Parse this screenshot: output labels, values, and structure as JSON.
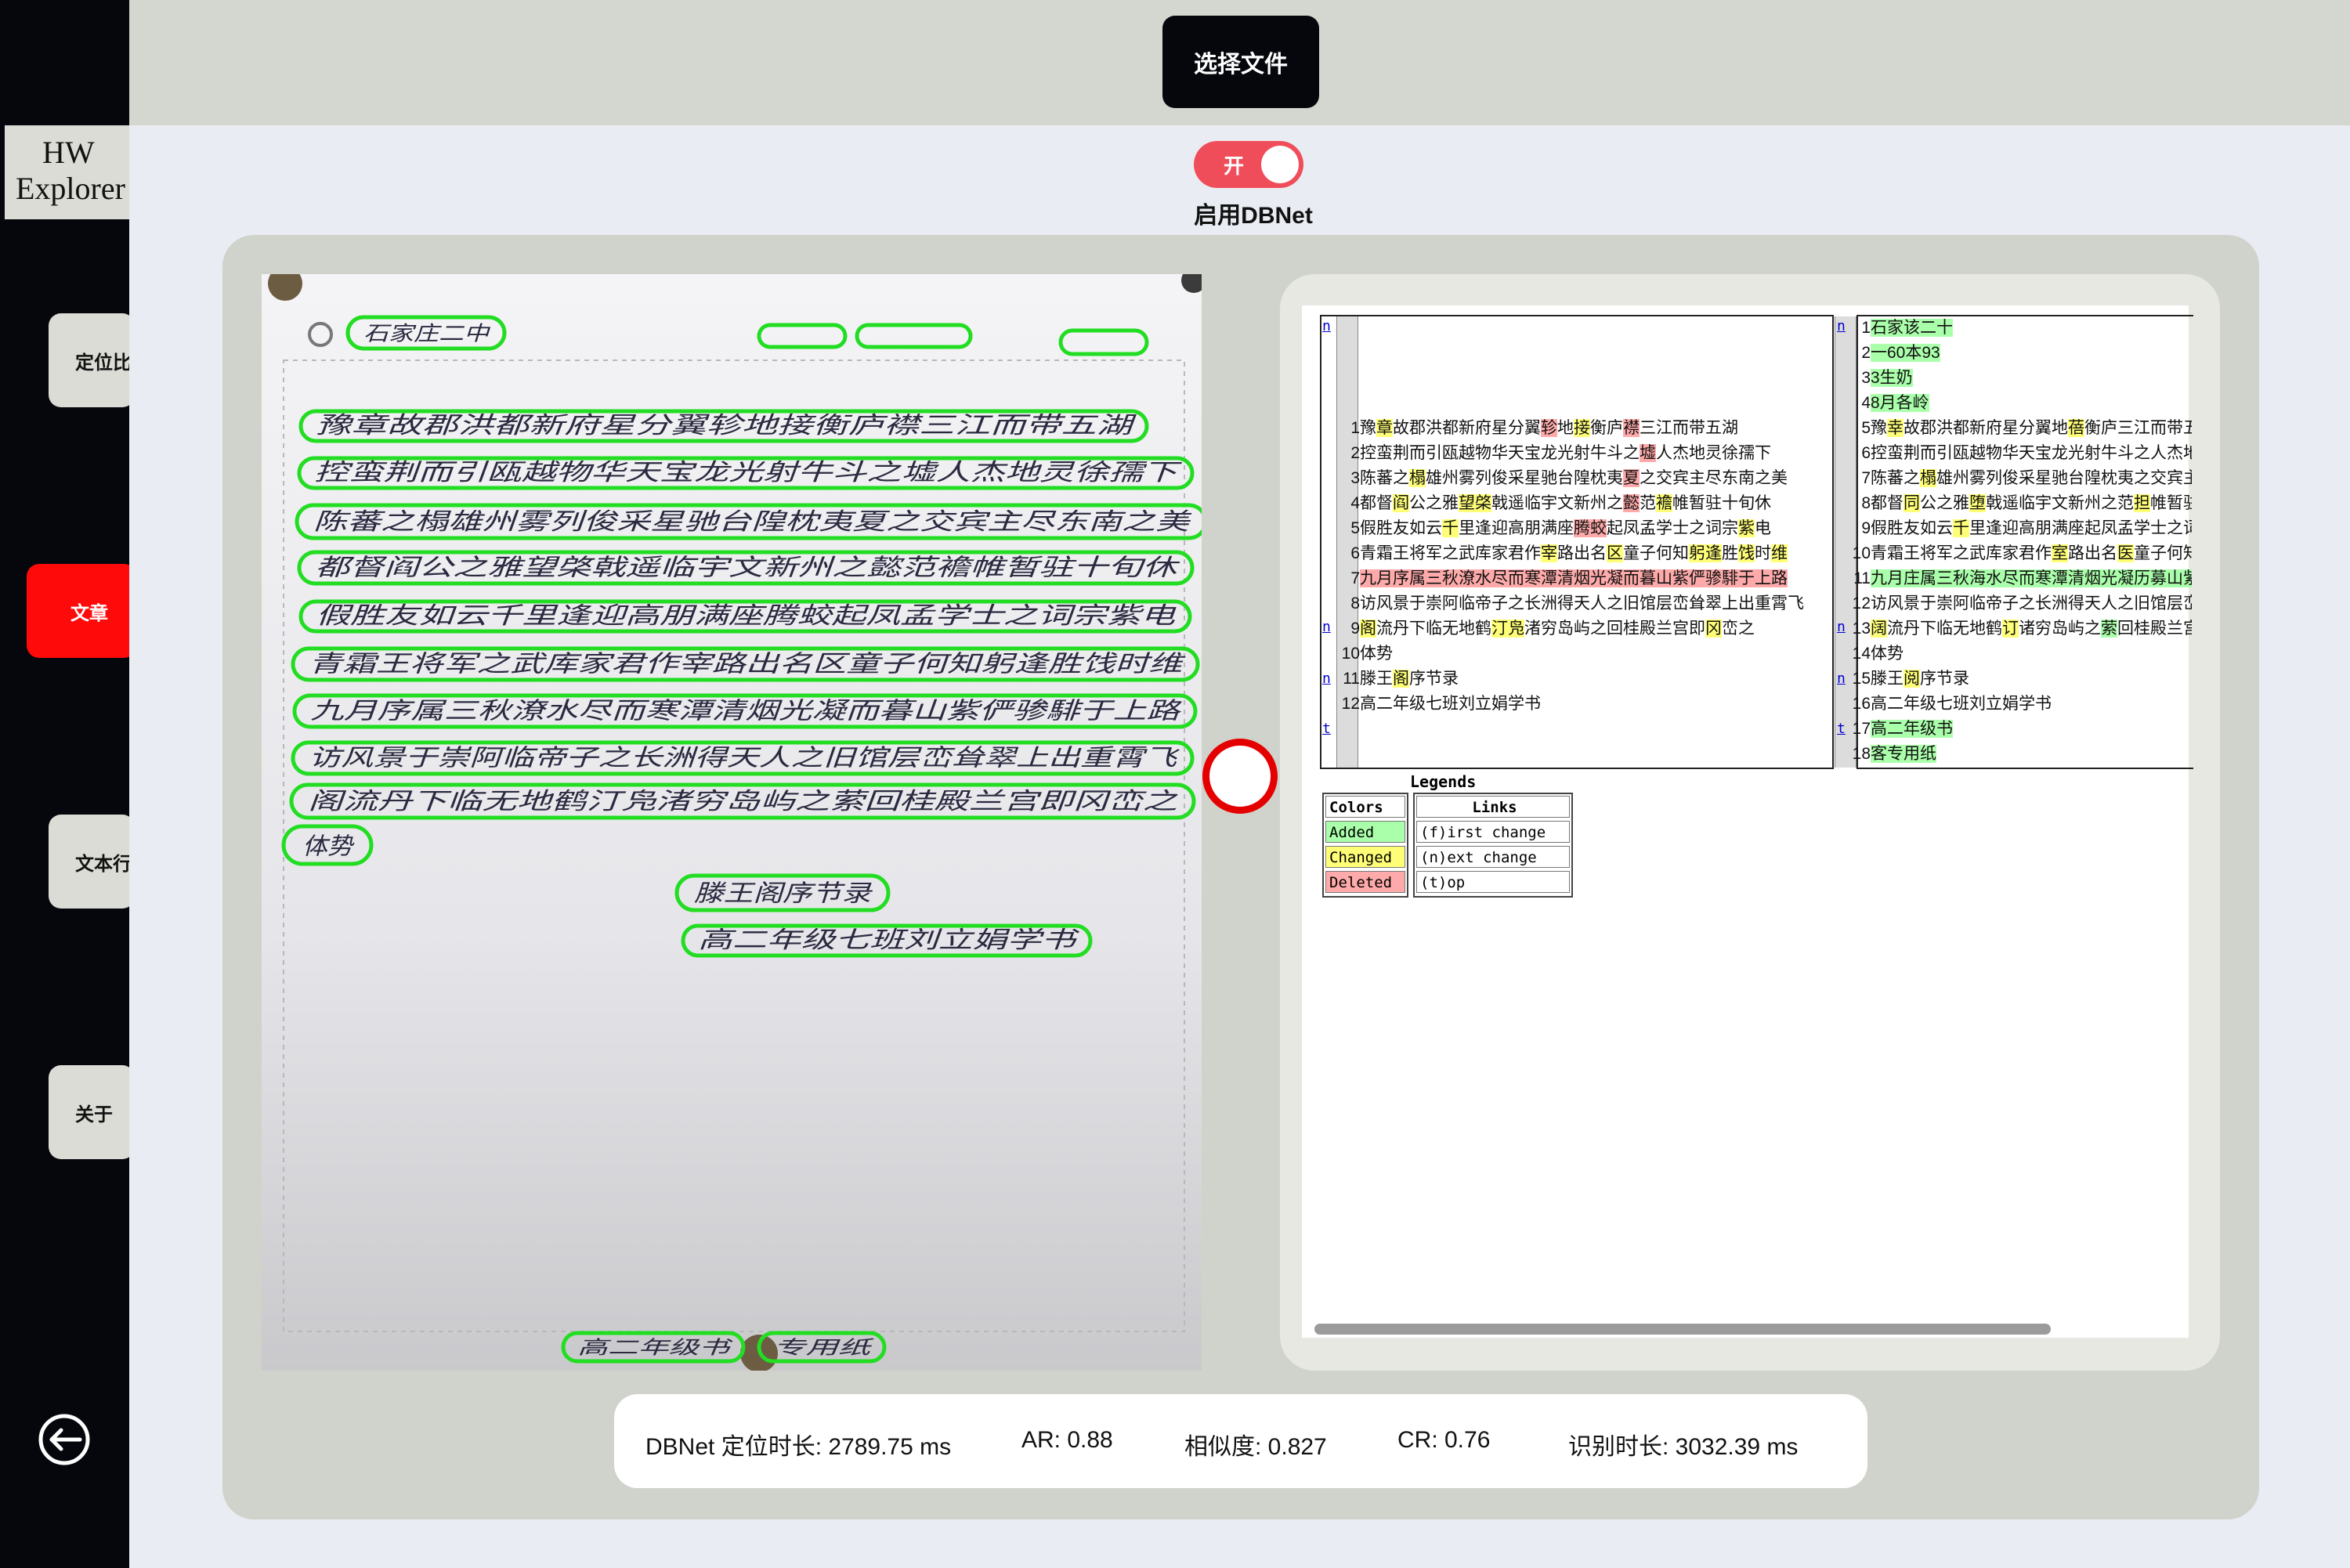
{
  "sidebar": {
    "brand_line1": "HW",
    "brand_line2": "Explorer",
    "items": [
      {
        "label": "定位比"
      },
      {
        "label": "文章"
      },
      {
        "label": "文本行"
      },
      {
        "label": "关于"
      }
    ]
  },
  "topbar": {
    "choose_file_label": "选择文件"
  },
  "toggle": {
    "state_text": "开",
    "label": "启用DBNet",
    "color": "#f04d5a"
  },
  "photo": {
    "header_texts": [
      "石家庄二中"
    ],
    "lines": [
      "豫章故郡洪都新府星分翼轸地接衡庐襟三江而带五湖",
      "控蛮荆而引瓯越物华天宝龙光射牛斗之墟人杰地灵徐孺下",
      "陈蕃之榻雄州雾列俊采星驰台隍枕夷夏之交宾主尽东南之美",
      "都督阎公之雅望棨戟遥临宇文新州之懿范襜帷暂驻十旬休",
      "假胜友如云千里逢迎高朋满座腾蛟起凤孟学士之词宗紫电",
      "青霜王将军之武库家君作宰路出名区童子何知躬逢胜饯时维",
      "九月序属三秋潦水尽而寒潭清烟光凝而暮山紫俨骖騑于上路",
      "访风景于崇阿临帝子之长洲得天人之旧馆层峦耸翠上出重霄飞",
      "阁流丹下临无地鹤汀凫渚穷岛屿之萦回桂殿兰宫即冈峦之",
      "体势",
      "滕王阁序节录",
      "高二年级七班刘立娟学书"
    ],
    "footer_texts": [
      "高二年级书",
      "专用纸"
    ]
  },
  "diff": {
    "left_links": [
      "n",
      "n",
      "n",
      "t"
    ],
    "right_links": [
      "n",
      "n",
      "n",
      "t"
    ],
    "left_rows": [
      {
        "n": "1",
        "segs": [
          {
            "t": "",
            "c": ""
          }
        ]
      },
      {
        "n": "2",
        "segs": [
          {
            "t": "",
            "c": ""
          }
        ]
      },
      {
        "n": "3",
        "segs": [
          {
            "t": "",
            "c": ""
          }
        ]
      },
      {
        "n": "4",
        "segs": [
          {
            "t": "",
            "c": ""
          }
        ]
      },
      {
        "n": "1",
        "segs": [
          {
            "t": "豫",
            "c": ""
          },
          {
            "t": "章",
            "c": "chg"
          },
          {
            "t": "故郡洪都新府星分翼",
            "c": ""
          },
          {
            "t": "轸",
            "c": "del"
          },
          {
            "t": "地",
            "c": ""
          },
          {
            "t": "接",
            "c": "chg"
          },
          {
            "t": "衡庐",
            "c": ""
          },
          {
            "t": "襟",
            "c": "del"
          },
          {
            "t": "三江而带五湖",
            "c": ""
          }
        ]
      },
      {
        "n": "2",
        "segs": [
          {
            "t": "控蛮荆而引瓯越物华天宝龙光射牛斗之",
            "c": ""
          },
          {
            "t": "墟",
            "c": "del"
          },
          {
            "t": "人杰地灵徐孺下",
            "c": ""
          }
        ]
      },
      {
        "n": "3",
        "segs": [
          {
            "t": "陈蕃之",
            "c": ""
          },
          {
            "t": "榻",
            "c": "chg"
          },
          {
            "t": "雄州雾列俊采星驰台隍枕夷",
            "c": ""
          },
          {
            "t": "夏",
            "c": "del"
          },
          {
            "t": "之交宾主尽东南之美",
            "c": ""
          }
        ]
      },
      {
        "n": "4",
        "segs": [
          {
            "t": "都督",
            "c": ""
          },
          {
            "t": "阎",
            "c": "chg"
          },
          {
            "t": "公之雅",
            "c": ""
          },
          {
            "t": "望棨",
            "c": "chg"
          },
          {
            "t": "戟遥临宇文新州之",
            "c": ""
          },
          {
            "t": "懿",
            "c": "del"
          },
          {
            "t": "范",
            "c": ""
          },
          {
            "t": "襜",
            "c": "chg"
          },
          {
            "t": "帷暂驻十旬休",
            "c": ""
          }
        ]
      },
      {
        "n": "5",
        "segs": [
          {
            "t": "假胜友如云",
            "c": ""
          },
          {
            "t": "千",
            "c": "chg"
          },
          {
            "t": "里逢迎高朋满座",
            "c": ""
          },
          {
            "t": "腾蛟",
            "c": "del"
          },
          {
            "t": "起凤孟学士之词宗",
            "c": ""
          },
          {
            "t": "紫",
            "c": "chg"
          },
          {
            "t": "电",
            "c": ""
          }
        ]
      },
      {
        "n": "6",
        "segs": [
          {
            "t": "青霜王将军之武库家君作",
            "c": ""
          },
          {
            "t": "宰",
            "c": "chg"
          },
          {
            "t": "路出名",
            "c": ""
          },
          {
            "t": "区",
            "c": "chg"
          },
          {
            "t": "童子何知",
            "c": ""
          },
          {
            "t": "躬逢",
            "c": "chg"
          },
          {
            "t": "胜",
            "c": ""
          },
          {
            "t": "饯",
            "c": "chg"
          },
          {
            "t": "时",
            "c": ""
          },
          {
            "t": "维",
            "c": "chg"
          }
        ]
      },
      {
        "n": "7",
        "segs": [
          {
            "t": "九月序属三秋潦水尽而寒潭清烟光凝而暮山紫俨骖騑于上路",
            "c": "del"
          }
        ]
      },
      {
        "n": "8",
        "segs": [
          {
            "t": "访风景于崇阿临帝子之长洲得天人之旧馆层峦耸翠上出重霄飞",
            "c": ""
          }
        ]
      },
      {
        "n": "9",
        "segs": [
          {
            "t": "阁",
            "c": "chg"
          },
          {
            "t": "流丹下临无地鹤",
            "c": ""
          },
          {
            "t": "汀凫",
            "c": "chg"
          },
          {
            "t": "渚穷岛屿之回桂殿兰宫即",
            "c": ""
          },
          {
            "t": "冈",
            "c": "chg"
          },
          {
            "t": "峦之",
            "c": ""
          }
        ]
      },
      {
        "n": "10",
        "segs": [
          {
            "t": "体势",
            "c": ""
          }
        ]
      },
      {
        "n": "11",
        "segs": [
          {
            "t": "滕王",
            "c": ""
          },
          {
            "t": "阁",
            "c": "chg"
          },
          {
            "t": "序节录",
            "c": ""
          }
        ]
      },
      {
        "n": "12",
        "segs": [
          {
            "t": "高二年级七班刘立娟学书",
            "c": ""
          }
        ]
      }
    ],
    "right_rows": [
      {
        "n": "1",
        "segs": [
          {
            "t": "石家该二十",
            "c": "add"
          }
        ]
      },
      {
        "n": "2",
        "segs": [
          {
            "t": "一60本93",
            "c": "add"
          }
        ]
      },
      {
        "n": "3",
        "segs": [
          {
            "t": "3生奶",
            "c": "add"
          }
        ]
      },
      {
        "n": "4",
        "segs": [
          {
            "t": "8月各岭",
            "c": "add"
          }
        ]
      },
      {
        "n": "5",
        "segs": [
          {
            "t": "豫",
            "c": ""
          },
          {
            "t": "幸",
            "c": "chg"
          },
          {
            "t": "故郡洪都新府星分翼地",
            "c": ""
          },
          {
            "t": "蓓",
            "c": "chg"
          },
          {
            "t": "衡庐三江而带五湖",
            "c": ""
          }
        ]
      },
      {
        "n": "6",
        "segs": [
          {
            "t": "控蛮荆而引瓯越物华天宝龙光射牛斗之人杰地灵",
            "c": ""
          }
        ]
      },
      {
        "n": "7",
        "segs": [
          {
            "t": "陈蕃之",
            "c": ""
          },
          {
            "t": "榻",
            "c": "chg"
          },
          {
            "t": "雄州雾列俊采星驰台隍枕夷之交宾主尽东南之美",
            "c": ""
          }
        ]
      },
      {
        "n": "8",
        "segs": [
          {
            "t": "都督",
            "c": ""
          },
          {
            "t": "同",
            "c": "chg"
          },
          {
            "t": "公之雅",
            "c": ""
          },
          {
            "t": "堕",
            "c": "chg"
          },
          {
            "t": "戟遥临宇文新州之范",
            "c": ""
          },
          {
            "t": "担",
            "c": "chg"
          },
          {
            "t": "帷暂驻十旬休",
            "c": ""
          }
        ]
      },
      {
        "n": "9",
        "segs": [
          {
            "t": "假胜友如云",
            "c": ""
          },
          {
            "t": "千",
            "c": "chg"
          },
          {
            "t": "里逢迎高朋满座起凤孟学士之词宗紫电",
            "c": ""
          }
        ]
      },
      {
        "n": "10",
        "segs": [
          {
            "t": "青霜王将军之武库家君作",
            "c": ""
          },
          {
            "t": "室",
            "c": "chg"
          },
          {
            "t": "路出名",
            "c": ""
          },
          {
            "t": "医",
            "c": "chg"
          },
          {
            "t": "童子何知躬逢胜饯时维",
            "c": ""
          }
        ]
      },
      {
        "n": "11",
        "segs": [
          {
            "t": "九月庄属三秋海水尽而寒潭清烟光凝历募山紫俨骖騑于上路",
            "c": "add"
          }
        ]
      },
      {
        "n": "12",
        "segs": [
          {
            "t": "访风景于崇阿临帝子之长洲得天人之旧馆层峦耸翠上出重霄飞",
            "c": ""
          }
        ]
      },
      {
        "n": "13",
        "segs": [
          {
            "t": "阔",
            "c": "chg"
          },
          {
            "t": "流丹下临无地鹤",
            "c": ""
          },
          {
            "t": "订",
            "c": "chg"
          },
          {
            "t": "诸穷岛屿之",
            "c": ""
          },
          {
            "t": "萦",
            "c": "add"
          },
          {
            "t": "回桂殿兰宫即冈峦之",
            "c": ""
          }
        ]
      },
      {
        "n": "14",
        "segs": [
          {
            "t": "体势",
            "c": ""
          }
        ]
      },
      {
        "n": "15",
        "segs": [
          {
            "t": "滕王",
            "c": ""
          },
          {
            "t": "阅",
            "c": "chg"
          },
          {
            "t": "序节录",
            "c": ""
          }
        ]
      },
      {
        "n": "16",
        "segs": [
          {
            "t": "高二年级七班刘立娟学书",
            "c": ""
          }
        ]
      },
      {
        "n": "17",
        "segs": [
          {
            "t": "高二年级书",
            "c": "add"
          }
        ]
      },
      {
        "n": "18",
        "segs": [
          {
            "t": "客专用纸",
            "c": "add"
          }
        ]
      }
    ],
    "legends": {
      "title": "Legends",
      "colors_header": "Colors",
      "links_header": "Links",
      "added": "Added",
      "changed": "Changed",
      "deleted": "Deleted",
      "first": "(f)irst change",
      "next": "(n)ext change",
      "top": "(t)op"
    },
    "colors": {
      "added": "#aaffaa",
      "changed": "#ffff77",
      "deleted": "#ffaaaa"
    }
  },
  "stats": {
    "dbnet_time": "DBNet 定位时长: 2789.75 ms",
    "ar": "AR: 0.88",
    "similarity": "相似度: 0.827",
    "cr": "CR: 0.76",
    "recog_time": "识别时长: 3032.39 ms"
  }
}
